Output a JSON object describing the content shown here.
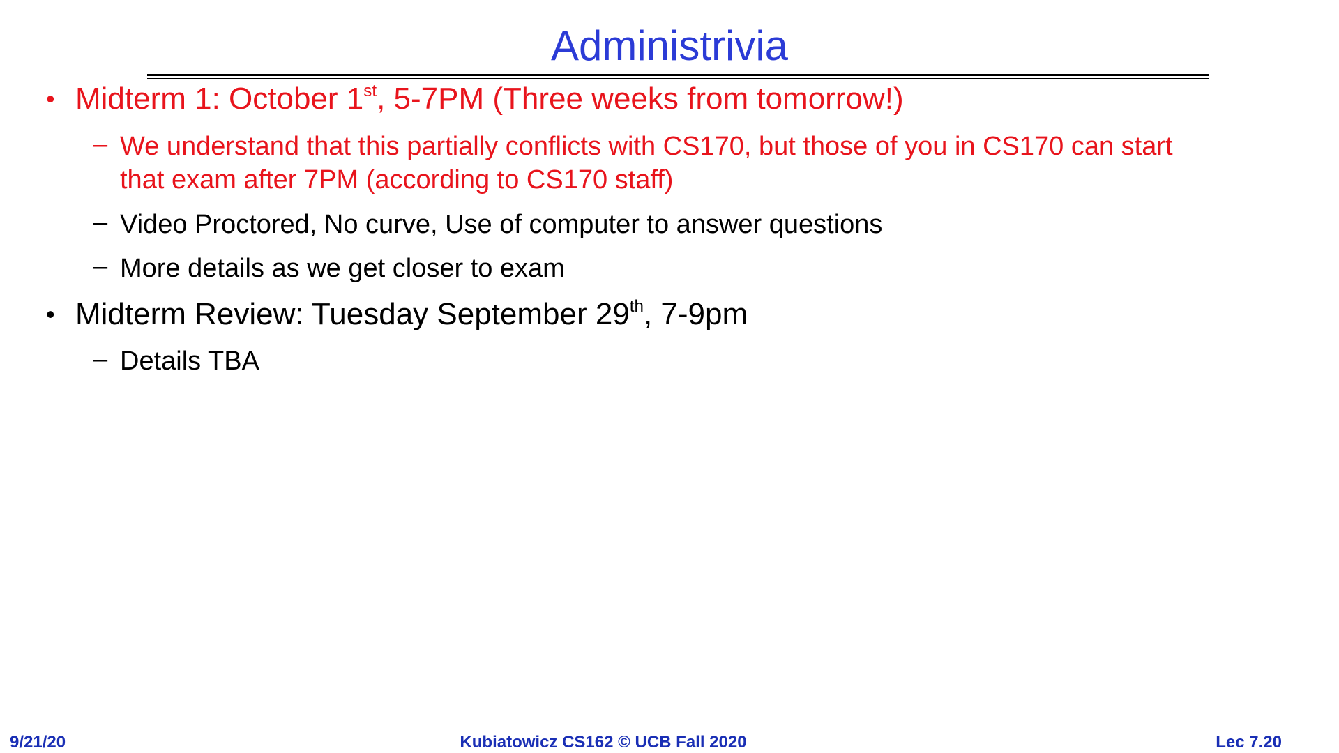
{
  "slide": {
    "title": "Administrivia",
    "bullets": [
      {
        "text_before_sup": "Midterm 1: October 1",
        "sup": "st",
        "text_after_sup": ", 5-7PM (Three weeks from tomorrow!)",
        "subitems": [
          {
            "line1": "We understand that this partially conflicts with CS170, but those of you in CS170 can start",
            "line2": "that exam after 7PM (according to CS170 staff)"
          },
          {
            "line1": "Video Proctored, No curve, Use of computer to answer questions"
          },
          {
            "line1": "More details as we get closer to exam"
          }
        ]
      },
      {
        "text_before_sup": "Midterm Review: Tuesday September 29",
        "sup": "th",
        "text_after_sup": ", 7-9pm",
        "subitems": [
          {
            "line1": "Details TBA"
          }
        ]
      }
    ],
    "bullet_glyph": "•",
    "dash_glyph": "–"
  },
  "footer": {
    "date": "9/21/20",
    "course": "Kubiatowicz CS162 © UCB Fall 2020",
    "lecture": "Lec 7.20"
  },
  "colors": {
    "title": "#2b3bd6",
    "highlight": "#e8141c",
    "body": "#000000",
    "footer": "#1a2fb5"
  }
}
